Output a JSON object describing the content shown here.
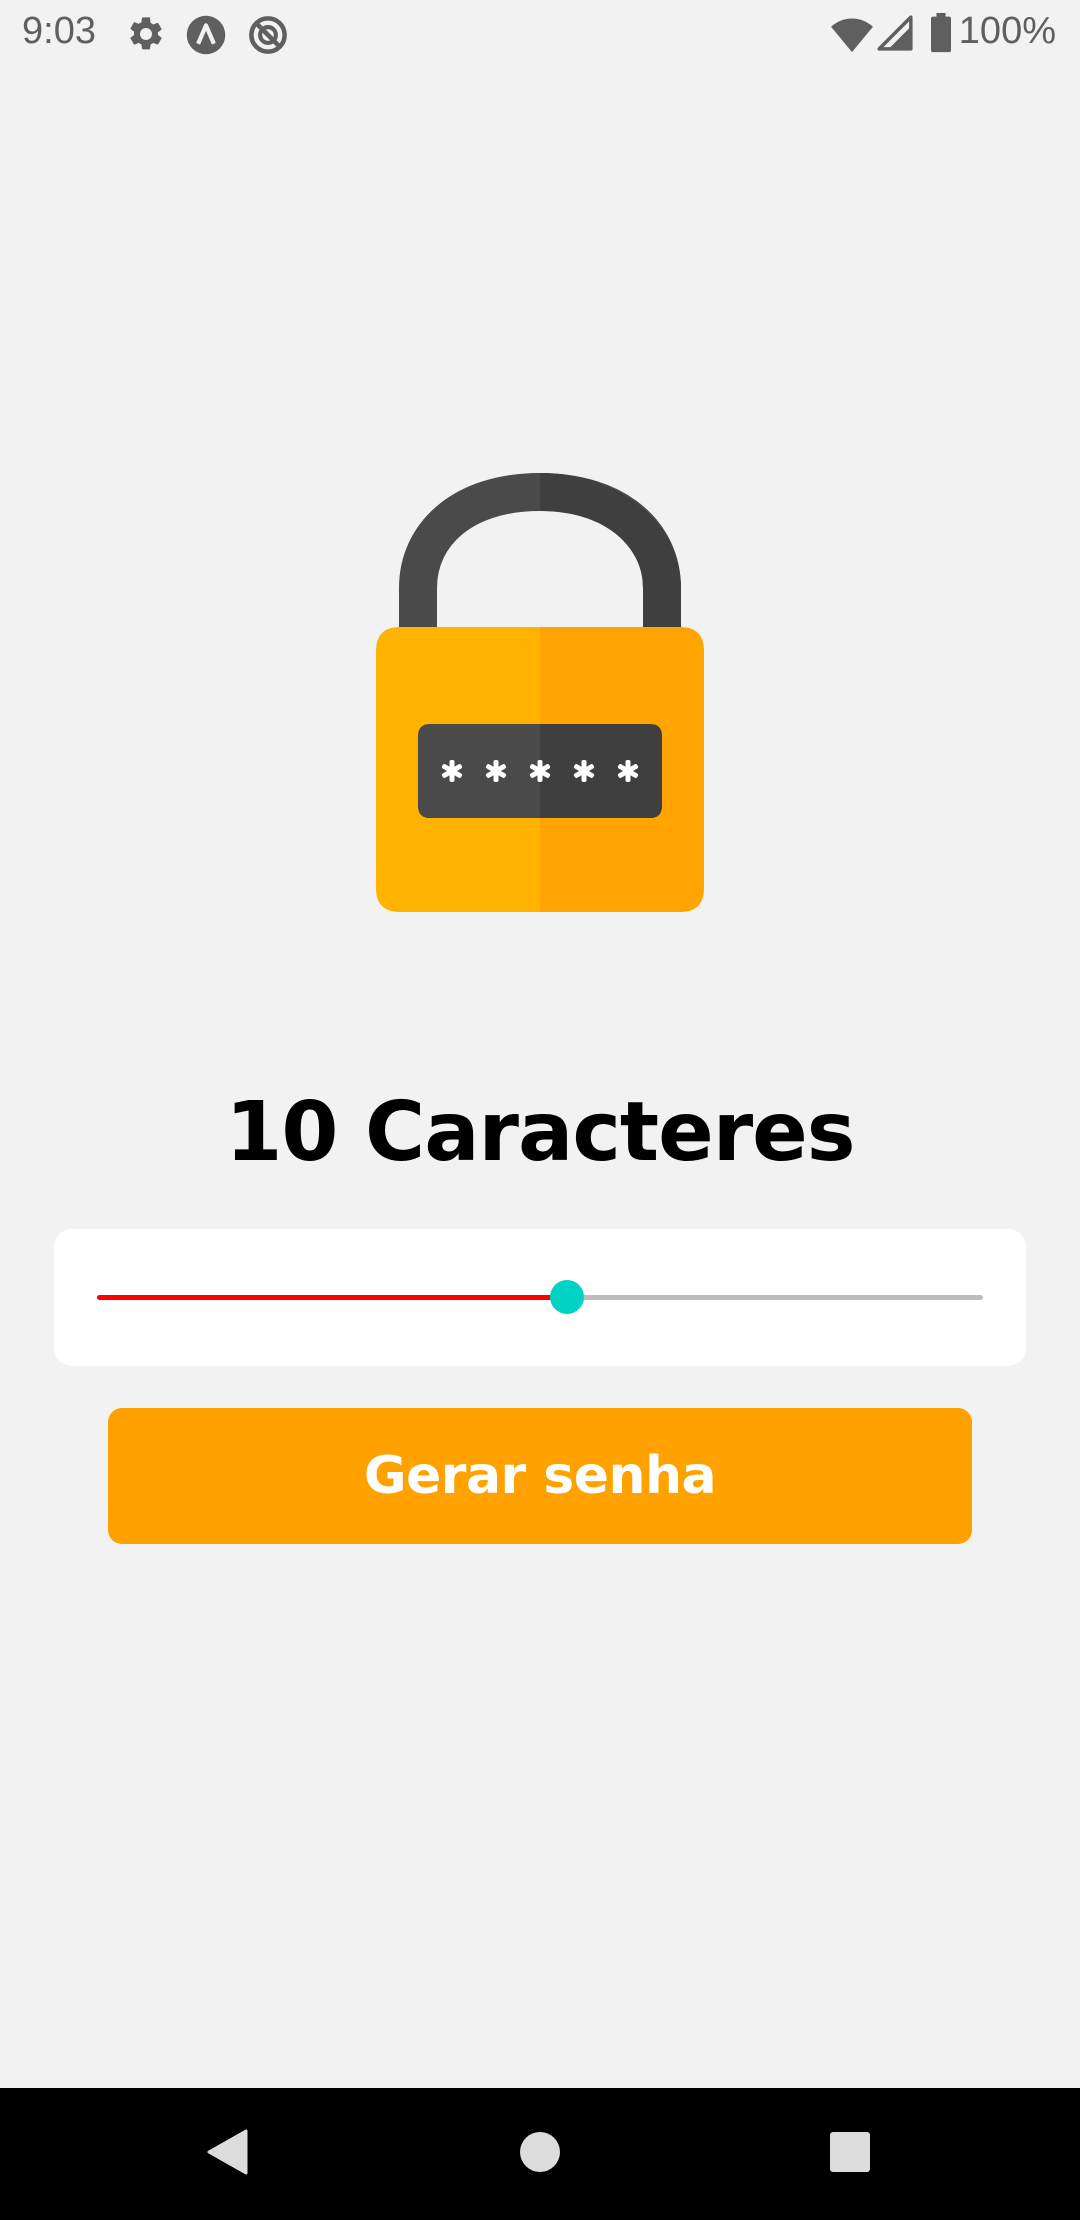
{
  "status_bar": {
    "time": "9:03",
    "battery": "100%",
    "icons": [
      "settings-icon",
      "app-a-icon",
      "no-sync-icon",
      "wifi-icon",
      "signal-icon",
      "battery-icon"
    ]
  },
  "hero": {
    "icon": "padlock-password-icon"
  },
  "length_title": "10 Caracteres",
  "slider": {
    "value_fraction": 0.53,
    "fill_color": "#ff0000",
    "track_color": "#bdbdbd",
    "thumb_color": "#00d3c4"
  },
  "generate_button": {
    "label": "Gerar senha",
    "color": "#ffa200"
  },
  "nav_bar": {
    "icons": [
      "back-icon",
      "home-icon",
      "recents-icon"
    ]
  }
}
